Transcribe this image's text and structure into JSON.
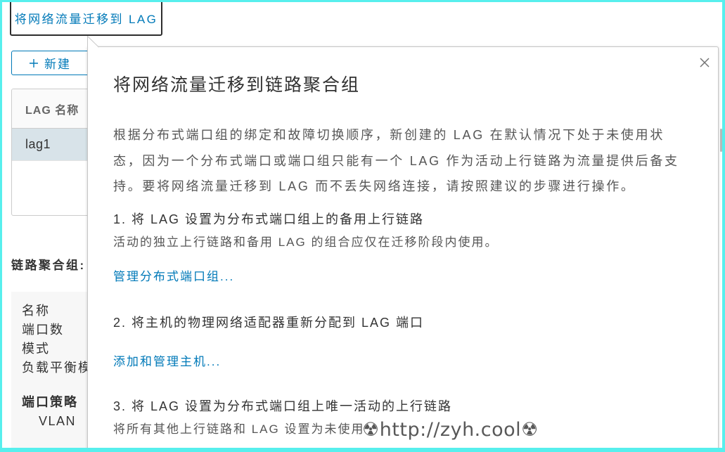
{
  "toolbar": {
    "migrate_label": "将网络流量迁移到 LAG",
    "new_label": "新建",
    "new_icon": "plus-icon"
  },
  "lag_table": {
    "columns": [
      "LAG 名称"
    ],
    "rows": [
      {
        "name": "lag1",
        "selected": true
      }
    ]
  },
  "details": {
    "title": "链路聚合组:",
    "fields": [
      "名称",
      "端口数",
      "模式",
      "负载平衡模"
    ],
    "policy_title": "端口策略",
    "policy_fields": [
      "VLAN"
    ]
  },
  "popover": {
    "title": "将网络流量迁移到链路聚合组",
    "close_icon": "close-icon",
    "description": "根据分布式端口组的绑定和故障切换顺序，新创建的 LAG 在默认情况下处于未使用状态，因为一个分布式端口或端口组只能有一个 LAG 作为活动上行链路为流量提供后备支持。要将网络流量迁移到 LAG 而不丢失网络连接，请按照建议的步骤进行操作。",
    "steps": [
      {
        "title": "1. 将 LAG 设置为分布式端口组上的备用上行链路",
        "note": "活动的独立上行链路和备用 LAG 的组合应仅在迁移阶段内使用。",
        "link": "管理分布式端口组..."
      },
      {
        "title": "2. 将主机的物理网络适配器重新分配到 LAG 端口",
        "link": "添加和管理主机..."
      },
      {
        "title": "3. 将 LAG 设置为分布式端口组上唯一活动的上行链路",
        "note": "将所有其他上行链路和 LAG 设置为未使用"
      }
    ]
  },
  "watermark": "☢http://zyh.cool☢",
  "colors": {
    "accent": "#0079b8",
    "selected_row": "#d8e3e9",
    "frame": "#57efed",
    "popover_border": "#c6c6c6"
  }
}
